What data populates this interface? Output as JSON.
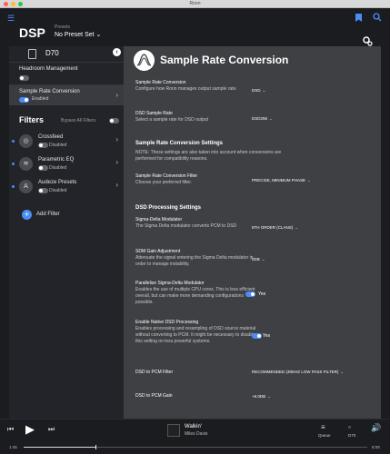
{
  "window": {
    "title": "Roon"
  },
  "header": {
    "title": "DSP",
    "presets_label": "Presets",
    "preset_value": "No Preset Set"
  },
  "sidebar": {
    "device": "D70",
    "items": [
      {
        "label": "Headroom Management",
        "enabled": false
      },
      {
        "label": "Sample Rate Conversion",
        "status": "Enabled",
        "enabled": true
      }
    ],
    "filters_title": "Filters",
    "bypass_label": "Bypass All Filters",
    "filters": [
      {
        "name": "Crossfeed",
        "status": "Disabled"
      },
      {
        "name": "Parametric EQ",
        "status": "Disabled"
      },
      {
        "name": "Audeze Presets",
        "status": "Disabled"
      }
    ],
    "add_filter": "Add Filter"
  },
  "main": {
    "title": "Sample Rate Conversion",
    "settings": [
      {
        "label": "Sample Rate Conversion",
        "desc": "Configure how Roon manages output sample rate.",
        "value": "DSD"
      },
      {
        "label": "DSD Sample Rate",
        "desc": "Select a sample rate for DSD output",
        "value": "DSD256"
      }
    ],
    "src_settings_title": "Sample Rate Conversion Settings",
    "src_note": "NOTE: These settings are also taken into account when conversions are performed for compatibility reasons.",
    "filter_setting": {
      "label": "Sample Rate Conversion Filter",
      "desc": "Choose your preferred filter.",
      "value": "PRECISE, MINIMUM PHASE"
    },
    "dsd_title": "DSD Processing Settings",
    "dsd_settings": [
      {
        "label": "Sigma-Delta Modulator",
        "desc": "The Sigma Delta modulator converts PCM to DSD",
        "value": "5TH ORDER (CLANS)"
      },
      {
        "label": "SDM Gain Adjustment",
        "desc": "Attenuate the signal entering the Sigma Delta modulator in order to manage instability.",
        "value": "0DB"
      },
      {
        "label": "Parallelize Sigma-Delta Modulator",
        "desc": "Enables the use of multiple CPU cores. This is less efficient overall, but can make more demanding configurations possible.",
        "value": "Yes"
      },
      {
        "label": "Enable Native DSD Processing",
        "desc": "Enables processing and resampling of DSD source material without converting to PCM. It might be necessary to disable this setting on less powerful systems.",
        "value": "Yes"
      },
      {
        "label": "DSD to PCM Filter",
        "desc": "",
        "value": "RECOMMENDED (30KHZ LOW PASS FILTER)"
      },
      {
        "label": "DSD to PCM Gain",
        "desc": "",
        "value": "+6.0DB"
      }
    ]
  },
  "player": {
    "song": "Walkin'",
    "artist": "Miles Davis",
    "queue_label": "Queue",
    "zone_label": "D70",
    "elapsed": "1:45",
    "total": "8:08",
    "progress": 0.21
  },
  "colors": {
    "accent": "#4a8df8",
    "bg": "#1b1c1f",
    "panel": "#3f4044",
    "sidebar": "#232429"
  }
}
